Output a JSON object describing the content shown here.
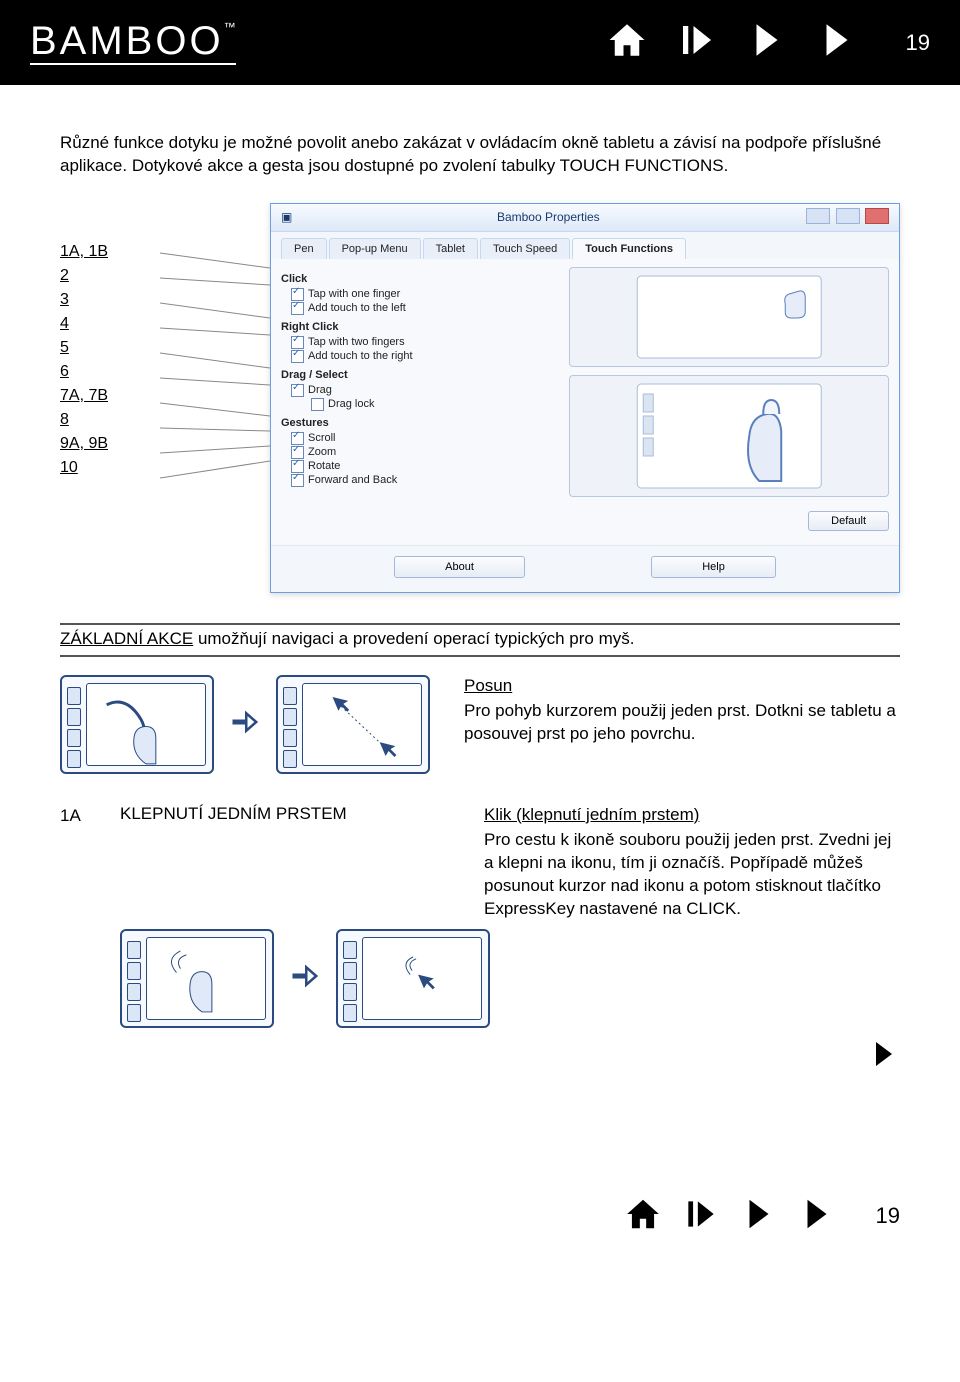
{
  "page_number": "19",
  "logo": "BAMBOO",
  "intro": "Různé funkce dotyku je možné povolit anebo zakázat v ovládacím okně tabletu a závisí na podpoře příslušné aplikace. Dotykové akce a gesta jsou dostupné po zvolení tabulky TOUCH FUNCTIONS.",
  "callouts": [
    "1A, 1B",
    "2",
    "3",
    "4",
    "5",
    "6",
    "7A, 7B",
    "8",
    "9A, 9B",
    "10"
  ],
  "window": {
    "title": "Bamboo Properties",
    "tabs": [
      "Pen",
      "Pop-up Menu",
      "Tablet",
      "Touch Speed",
      "Touch Functions"
    ],
    "active_tab": "Touch Functions",
    "sections": {
      "click": "Click",
      "click_opts": [
        "Tap with one finger",
        "Add touch to the left"
      ],
      "right": "Right Click",
      "right_opts": [
        "Tap with two fingers",
        "Add touch to the right"
      ],
      "drag": "Drag / Select",
      "drag_opts": [
        "Drag",
        "Drag lock"
      ],
      "gest": "Gestures",
      "gest_opts": [
        "Scroll",
        "Zoom",
        "Rotate",
        "Forward and Back"
      ]
    },
    "default_btn": "Default",
    "about_btn": "About",
    "help_btn": "Help"
  },
  "subhead_prefix": "ZÁKLADNÍ AKCE",
  "subhead_rest": " umožňují navigaci a provedení operací typických pro myš.",
  "posun": {
    "title": "Posun",
    "body": "Pro pohyb kurzorem použij jeden prst. Dotkni se tabletu a posouvej prst po jeho povrchu."
  },
  "row1a": {
    "label": "1A",
    "title": "KLEPNUTÍ JEDNÍM PRSTEM",
    "link": "Klik (klepnutí jedním prstem)",
    "body": "Pro cestu k ikoně souboru použij jeden prst. Zvedni jej  a klepni na ikonu, tím ji označíš. Popřípadě můžeš posunout kurzor nad ikonu a potom stisknout tlačítko ExpressKey nastavené na CLICK."
  }
}
